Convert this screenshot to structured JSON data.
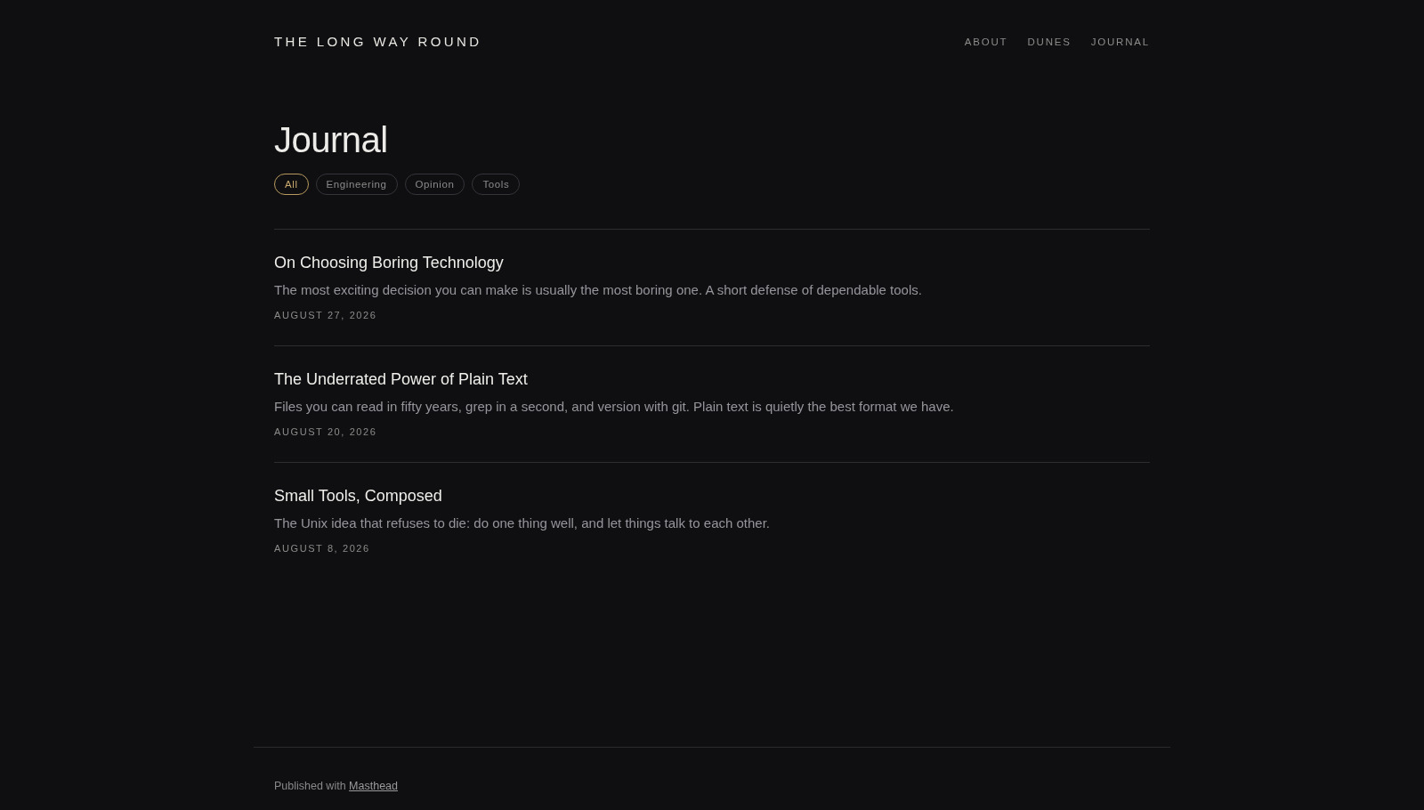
{
  "site_title": "THE LONG WAY ROUND",
  "nav": [
    {
      "label": "ABOUT"
    },
    {
      "label": "DUNES"
    },
    {
      "label": "JOURNAL"
    }
  ],
  "heading": "Journal",
  "filters": [
    {
      "label": "All",
      "selected": true
    },
    {
      "label": "Engineering",
      "selected": false
    },
    {
      "label": "Opinion",
      "selected": false
    },
    {
      "label": "Tools",
      "selected": false
    }
  ],
  "posts": [
    {
      "title": "On Choosing Boring Technology",
      "excerpt": "The most exciting decision you can make is usually the most boring one. A short defense of dependable tools.",
      "date": "AUGUST 27, 2026"
    },
    {
      "title": "The Underrated Power of Plain Text",
      "excerpt": "Files you can read in fifty years, grep in a second, and version with git. Plain text is quietly the best format we have.",
      "date": "AUGUST 20, 2026"
    },
    {
      "title": "Small Tools, Composed",
      "excerpt": "The Unix idea that refuses to die: do one thing well, and let things talk to each other.",
      "date": "AUGUST 8, 2026"
    }
  ],
  "footer": {
    "text": "Published with",
    "link": "Masthead"
  }
}
